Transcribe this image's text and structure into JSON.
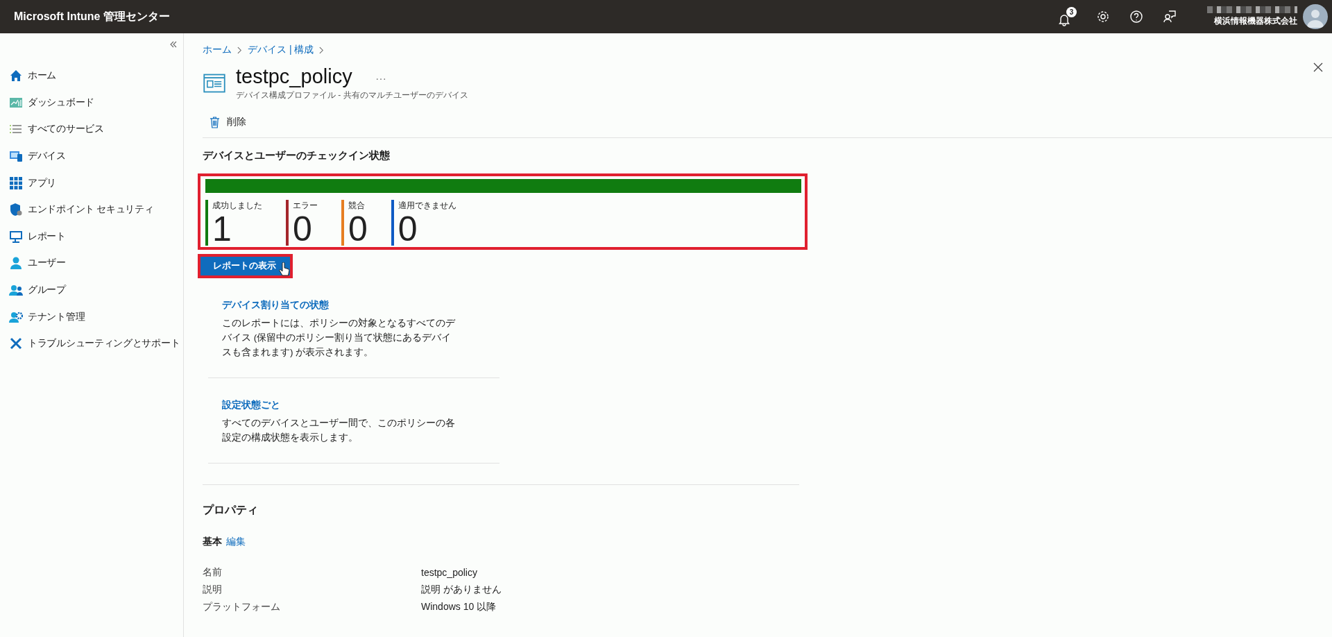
{
  "topbar": {
    "title": "Microsoft Intune 管理センター",
    "notification_count": "3",
    "tenant": "横浜情報機器株式会社"
  },
  "sidebar": {
    "items": [
      {
        "label": "ホーム",
        "kind": "home"
      },
      {
        "label": "ダッシュボード",
        "kind": "dashboard"
      },
      {
        "label": "すべてのサービス",
        "kind": "list"
      },
      {
        "label": "デバイス",
        "kind": "devices"
      },
      {
        "label": "アプリ",
        "kind": "apps"
      },
      {
        "label": "エンドポイント セキュリティ",
        "kind": "shield"
      },
      {
        "label": "レポート",
        "kind": "monitor"
      },
      {
        "label": "ユーザー",
        "kind": "user"
      },
      {
        "label": "グループ",
        "kind": "group"
      },
      {
        "label": "テナント管理",
        "kind": "tenant"
      },
      {
        "label": "トラブルシューティングとサポート",
        "kind": "tools"
      }
    ]
  },
  "breadcrumb": [
    "ホーム",
    "デバイス | 構成"
  ],
  "page": {
    "title": "testpc_policy",
    "subtitle": "デバイス構成プロファイル - 共有のマルチユーザーのデバイス"
  },
  "toolbar": [
    {
      "label": "削除"
    }
  ],
  "checkin": {
    "heading": "デバイスとユーザーのチェックイン状態",
    "highlighted": true,
    "bar": [
      {
        "level": 1,
        "color": "#107c10"
      }
    ],
    "stats": [
      {
        "label": "成功しました",
        "value": "1",
        "color": "#107c10"
      },
      {
        "label": "エラー",
        "value": "0",
        "color": "#a4262c"
      },
      {
        "label": "競合",
        "value": "0",
        "color": "#e67e22"
      },
      {
        "label": "適用できません",
        "value": "0",
        "color": "#0f5bc4"
      }
    ],
    "button": {
      "label": "レポートの表示",
      "highlighted": true
    }
  },
  "reports": [
    {
      "title": "デバイス割り当ての状態",
      "description": "このレポートには、ポリシーの対象となるすべてのデバイス (保留中のポリシー割り当て状態にあるデバイスも含まれます) が表示されます。"
    },
    {
      "title": "設定状態ごと",
      "description": "すべてのデバイスとユーザー間で、このポリシーの各設定の構成状態を表示します。"
    }
  ],
  "properties": {
    "heading": "プロパティ",
    "section": "基本",
    "edit_link": "編集",
    "rows": [
      {
        "label": "名前",
        "value": "testpc_policy"
      },
      {
        "label": "説明",
        "value": "説明 がありません"
      },
      {
        "label": "プラットフォーム",
        "value": "Windows 10 以降"
      }
    ]
  }
}
